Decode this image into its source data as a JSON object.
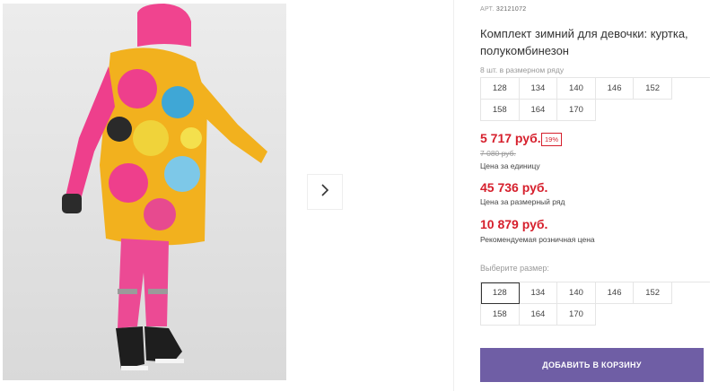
{
  "product": {
    "sku_label": "АРТ.",
    "sku": "32121072",
    "title": "Комплект зимний для девочки: куртка, полукомбинезон",
    "pack_note": "8 шт. в размерном ряду",
    "pack_sizes": [
      "128",
      "134",
      "140",
      "146",
      "152",
      "158",
      "164",
      "170"
    ]
  },
  "prices": {
    "unit_price": "5 717 руб.",
    "discount": "19%",
    "old_price": "7 080 руб.",
    "unit_label": "Цена за единицу",
    "pack_price": "45 736 руб.",
    "pack_label": "Цена за размерный ряд",
    "retail_price": "10 879 руб.",
    "retail_label": "Рекомендуемая розничная цена"
  },
  "size_picker": {
    "label": "Выберите размер:",
    "sizes": [
      "128",
      "134",
      "140",
      "146",
      "152",
      "158",
      "164",
      "170"
    ],
    "selected": "128"
  },
  "cart": {
    "button_label": "ДОБАВИТЬ В КОРЗИНУ"
  },
  "colors": {
    "price": "#d61f2c",
    "button": "#6f5ea5",
    "jacket_pink": "#ee3f8c",
    "pants_pink": "#ec4a94"
  },
  "icons": {
    "next": "chevron-right-icon"
  }
}
